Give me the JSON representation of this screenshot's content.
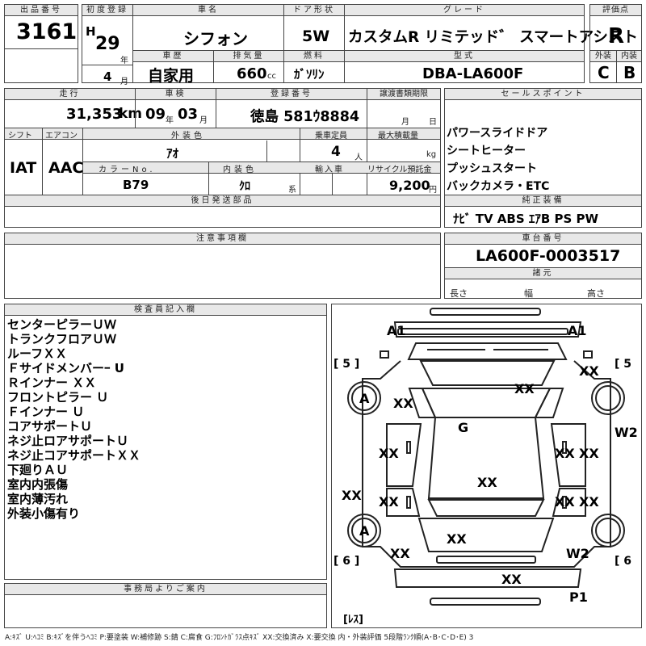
{
  "header": {
    "lot_no_label": "出品番号",
    "lot_no": "3161",
    "first_reg_label": "初度登録",
    "era": "H",
    "year": "29",
    "year_suffix": "年",
    "car_name_label": "車名",
    "car_name": "シフォン",
    "door_label": "ドア形状",
    "door": "5W",
    "grade_label": "グレード",
    "grade": "カスタムR リミテッド゛ スマートアシスト",
    "score_label": "評価点",
    "score": "R",
    "month": "4",
    "month_suffix": "月",
    "history_label": "車歴",
    "history": "自家用",
    "displacement_label": "排気量",
    "displacement": "660",
    "displacement_unit": "cc",
    "fuel_label": "燃料",
    "fuel": "ｶﾞｿﾘﾝ",
    "model_label": "型式",
    "model": "DBA-LA600F",
    "exterior_label": "外装",
    "exterior": "C",
    "interior_label": "内装",
    "interior": "B"
  },
  "row2": {
    "mileage_label": "走行",
    "mileage": "31,353",
    "mileage_unit": "km",
    "inspection_label": "車検",
    "insp_year": "09",
    "insp_year_suffix": "年",
    "insp_month": "03",
    "insp_month_suffix": "月",
    "plate_label": "登録番号",
    "plate": "徳島 581ｳ8884",
    "transfer_label": "譲渡書類期限",
    "transfer_month": "月",
    "transfer_day": "日",
    "shift_label": "シフト",
    "shift": "IAT",
    "ac_label": "エアコン",
    "ac": "AAC",
    "color_label": "外装色",
    "color": "ｱｵ",
    "capacity_label": "乗車定員",
    "capacity": "4",
    "capacity_unit": "人",
    "load_label": "最大積載量",
    "load_unit": "kg",
    "color_no_label": "カラーNo.",
    "color_no": "B79",
    "int_color_label": "内装色",
    "int_color": "ｸﾛ",
    "int_color_unit": "系",
    "import_label": "輸入車",
    "recycle_label": "リサイクル預託金",
    "recycle": "9,200",
    "recycle_unit": "円",
    "later_parts_label": "後日発送部品"
  },
  "sales": {
    "label": "セールスポイント",
    "items": [
      "パワースライドドア",
      "シートヒーター",
      "プッシュスタート",
      "バックカメラ・ETC"
    ]
  },
  "equipment": {
    "label": "純正装備",
    "value": "ﾅﾋﾞ TV ABS ｴｱB PS PW"
  },
  "notes": {
    "label": "注意事項欄"
  },
  "chassis": {
    "label": "車台番号",
    "value": "LA600F-0003517",
    "dims_label": "諸元",
    "length": "長さ",
    "width": "幅",
    "height": "高さ"
  },
  "inspector": {
    "label": "検査員記入欄",
    "lines": [
      "センターピラーＵＷ",
      "トランクフロアＵＷ",
      "ルーフＸＸ",
      "Ｆサイドメンバーｰ U",
      "Ｒインナー ＸＸ",
      "フロントピラー Ｕ",
      "Ｆインナー Ｕ",
      "コアサポートＵ",
      "ネジ止ロアサポートＵ",
      "ネジ止コアサポートＸＸ",
      "下廻りＡＵ",
      "室内内張傷",
      "室内薄汚れ",
      "外装小傷有り"
    ]
  },
  "office": {
    "label": "事務局よりご案内"
  },
  "legend": "A:ｷｽﾞ U:ﾍｺﾐ B:ｷｽﾞを伴うﾍｺﾐ P:要塗装 W:補修跡 S:錆 C:腐食 G:ﾌﾛﾝﾄｶﾞﾗｽ点ｷｽﾞ XX:交換済み X:要交換 内・外装評価 5段階ﾗﾝｸ順(A･B･C･D･E) 3",
  "diagram": {
    "marks": {
      "a1_left": "A1",
      "a1_right": "A1",
      "five_left": "[ 5 ]",
      "five_right": "[ 5",
      "six_left": "[ 6 ]",
      "six_right": "[ 6",
      "xx_fr": "XX",
      "xx_hood": "XX",
      "a_fl_wheel": "A",
      "xx_fl_fender": "XX",
      "g_glass": "G",
      "w2_right": "W2",
      "xx_fl_door": "XX",
      "xx_fr_door": "XX",
      "xx_fr_outer": "XX",
      "xx_roof": "XX",
      "xx_left_outer": "XX",
      "xx_rl_door": "XX",
      "xx_rr_door": "XX",
      "xx_rr_outer": "XX",
      "a_rl_wheel": "A",
      "xx_trunk": "XX",
      "xx_rl_quarter": "XX",
      "w2_rr": "W2",
      "xx_rear": "XX",
      "p1": "P1",
      "les": "[ﾚｽ]"
    }
  }
}
